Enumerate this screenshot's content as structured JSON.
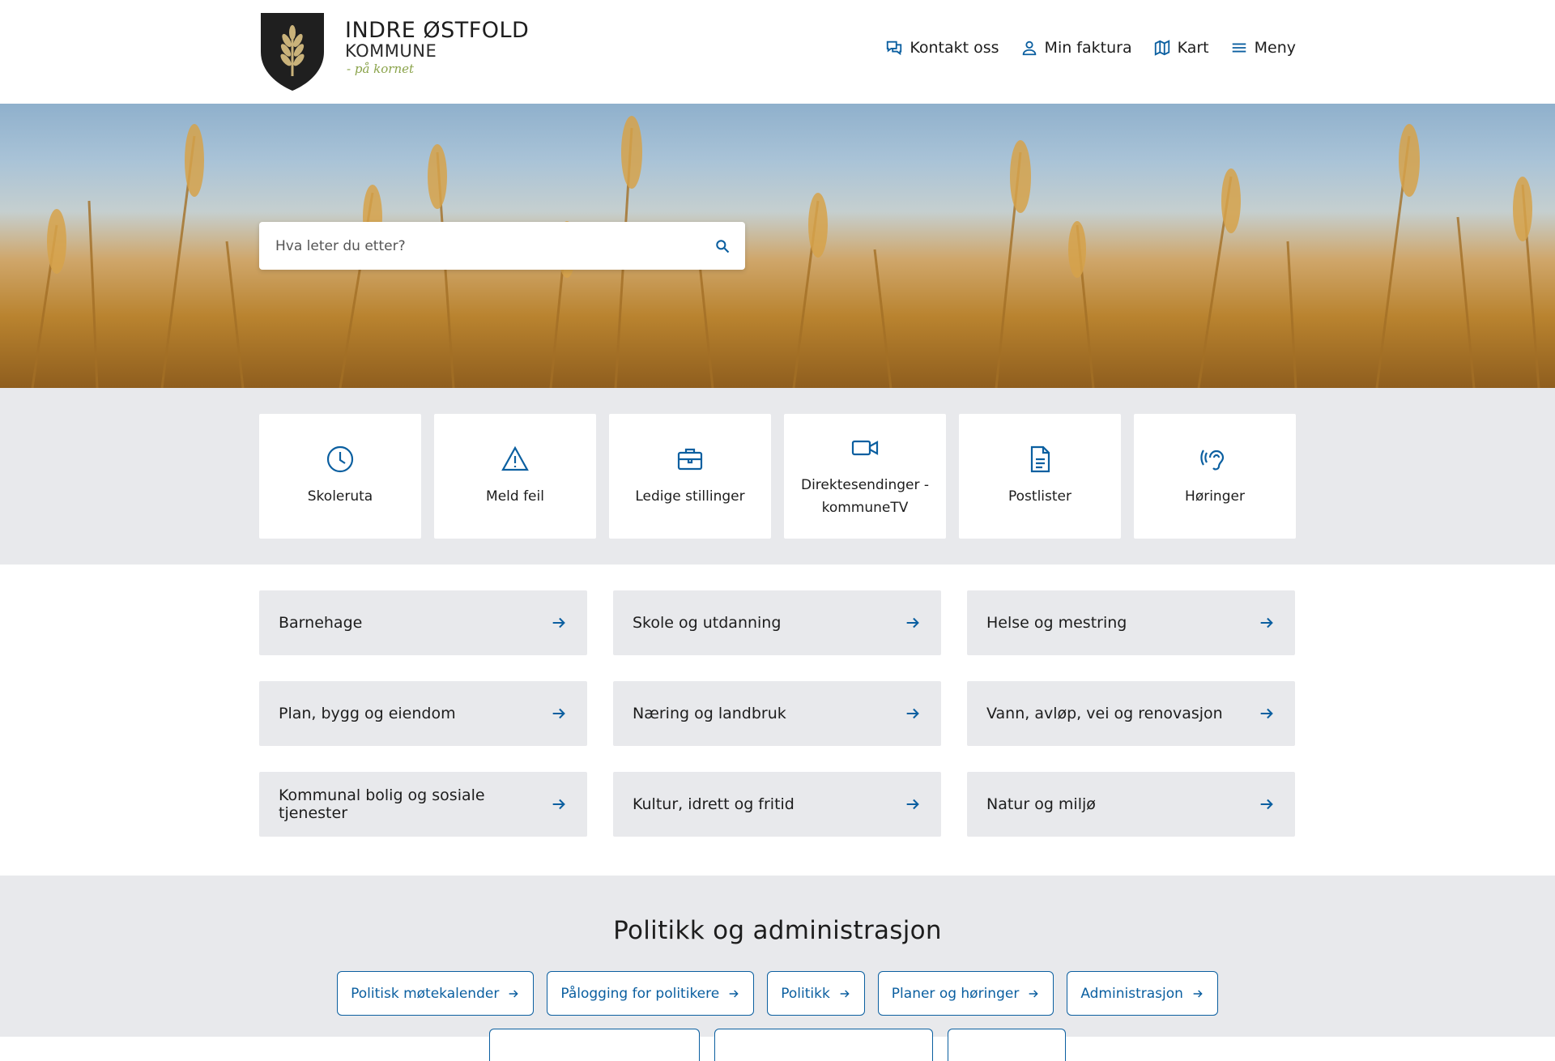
{
  "header": {
    "logo_title": "INDRE ØSTFOLD",
    "logo_subtitle": "KOMMUNE",
    "logo_tagline": "- på kornet",
    "nav": [
      {
        "label": "Kontakt oss",
        "icon": "chat-icon"
      },
      {
        "label": "Min faktura",
        "icon": "user-icon"
      },
      {
        "label": "Kart",
        "icon": "map-icon"
      },
      {
        "label": "Meny",
        "icon": "menu-icon"
      }
    ]
  },
  "search": {
    "placeholder": "Hva leter du etter?"
  },
  "shortcuts": [
    {
      "label": "Skoleruta",
      "icon": "clock-icon"
    },
    {
      "label": "Meld feil",
      "icon": "warning-icon"
    },
    {
      "label": "Ledige stillinger",
      "icon": "briefcase-icon"
    },
    {
      "label": "Direktesendinger - kommuneTV",
      "icon": "video-icon"
    },
    {
      "label": "Postlister",
      "icon": "document-icon"
    },
    {
      "label": "Høringer",
      "icon": "ear-icon"
    }
  ],
  "categories": [
    "Barnehage",
    "Skole og utdanning",
    "Helse og mestring",
    "Plan, bygg og eiendom",
    "Næring og landbruk",
    "Vann, avløp, vei og renovasjon",
    "Kommunal bolig og sosiale tjenester",
    "Kultur, idrett og fritid",
    "Natur og miljø"
  ],
  "politics": {
    "heading": "Politikk og administrasjon",
    "links": [
      "Politisk møtekalender",
      "Pålogging for politikere",
      "Politikk",
      "Planer og høringer",
      "Administrasjon"
    ]
  },
  "colors": {
    "accent": "#0b5fa0",
    "panel": "#e8e9ec",
    "shield": "#1f1f1f",
    "wheat": "#c9b27a"
  }
}
